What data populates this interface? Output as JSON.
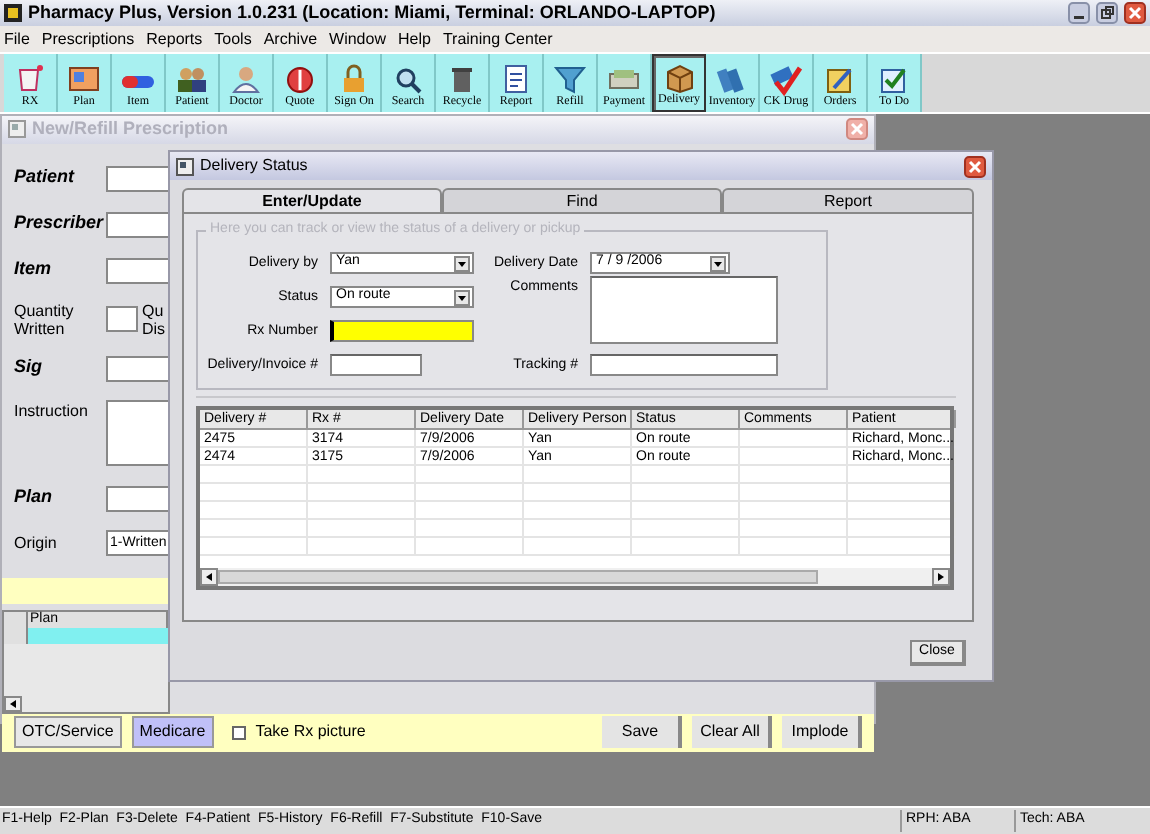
{
  "app_window": {
    "title": "Pharmacy Plus, Version 1.0.231 (Location: Miami, Terminal: ORLANDO-LAPTOP)",
    "menu": [
      "File",
      "Prescriptions",
      "Reports",
      "Tools",
      "Archive",
      "Window",
      "Help",
      "Training Center"
    ],
    "toolbar": [
      {
        "label": "RX",
        "selected": false
      },
      {
        "label": "Plan",
        "selected": false
      },
      {
        "label": "Item",
        "selected": false
      },
      {
        "label": "Patient",
        "selected": false
      },
      {
        "label": "Doctor",
        "selected": false
      },
      {
        "label": "Quote",
        "selected": false
      },
      {
        "label": "Sign On",
        "selected": false
      },
      {
        "label": "Search",
        "selected": false
      },
      {
        "label": "Recycle",
        "selected": false
      },
      {
        "label": "Report",
        "selected": false
      },
      {
        "label": "Refill",
        "selected": false
      },
      {
        "label": "Payment",
        "selected": false
      },
      {
        "label": "Delivery",
        "selected": true
      },
      {
        "label": "Inventory",
        "selected": false
      },
      {
        "label": "CK Drug",
        "selected": false
      },
      {
        "label": "Orders",
        "selected": false
      },
      {
        "label": "To Do",
        "selected": false
      }
    ]
  },
  "prescription_window": {
    "title": "New/Refill Prescription",
    "fields": [
      {
        "label": "Patient",
        "kind": "required"
      },
      {
        "label": "Prescriber",
        "kind": "required"
      },
      {
        "label": "Item",
        "kind": "required"
      },
      {
        "label": "Quantity Written",
        "kind": "pair",
        "second_label": [
          "Qu",
          "Dis"
        ]
      },
      {
        "label": "Sig",
        "kind": "required"
      },
      {
        "label": "Instruction",
        "kind": "multiline"
      },
      {
        "label": "Plan",
        "kind": "required"
      },
      {
        "label": "Origin",
        "kind": "value",
        "value": "1-Written"
      }
    ],
    "plan_grid": {
      "columns": [
        "Plan"
      ]
    },
    "bottom_bar": {
      "left_buttons": [
        {
          "label": "OTC/Service",
          "selected": false
        },
        {
          "label": "Medicare",
          "selected": true
        }
      ],
      "checkbox": {
        "label": "Take Rx picture",
        "checked": false
      },
      "right_buttons": [
        "Save",
        "Clear All",
        "Implode"
      ]
    }
  },
  "delivery_window": {
    "title": "Delivery Status",
    "tabs": [
      {
        "label": "Enter/Update",
        "selected": true
      },
      {
        "label": "Find",
        "selected": false
      },
      {
        "label": "Report",
        "selected": false
      }
    ],
    "group_legend": "Here you can track or view the status of a delivery or pickup",
    "delivery_by": {
      "label": "Delivery by",
      "value": "Yan"
    },
    "status": {
      "label": "Status",
      "value": "On route"
    },
    "rx_number": {
      "label": "Rx Number",
      "focused": true
    },
    "invoice": {
      "label": "Delivery/Invoice #"
    },
    "delivery_date": {
      "label": "Delivery Date",
      "value": "7 / 9 /2006"
    },
    "comments": {
      "label": "Comments"
    },
    "tracking": {
      "label": "Tracking #"
    },
    "grid": {
      "columns": [
        "Delivery #",
        "Rx #",
        "Delivery Date",
        "Delivery Person",
        "Status",
        "Comments",
        "Patient"
      ],
      "rows": [
        [
          "2475",
          "3174",
          "7/9/2006",
          "Yan",
          "On route",
          "",
          "Richard, Monc..."
        ],
        [
          "2474",
          "3175",
          "7/9/2006",
          "Yan",
          "On route",
          "",
          "Richard, Monc..."
        ]
      ]
    },
    "close_button": "Close"
  },
  "status_bar": {
    "keys": "F1-Help  F2-Plan  F3-Delete  F4-Patient  F5-History  F6-Refill  F7-Substitute  F10-Save",
    "rph": "RPH: ABA",
    "tech": "Tech: ABA"
  }
}
